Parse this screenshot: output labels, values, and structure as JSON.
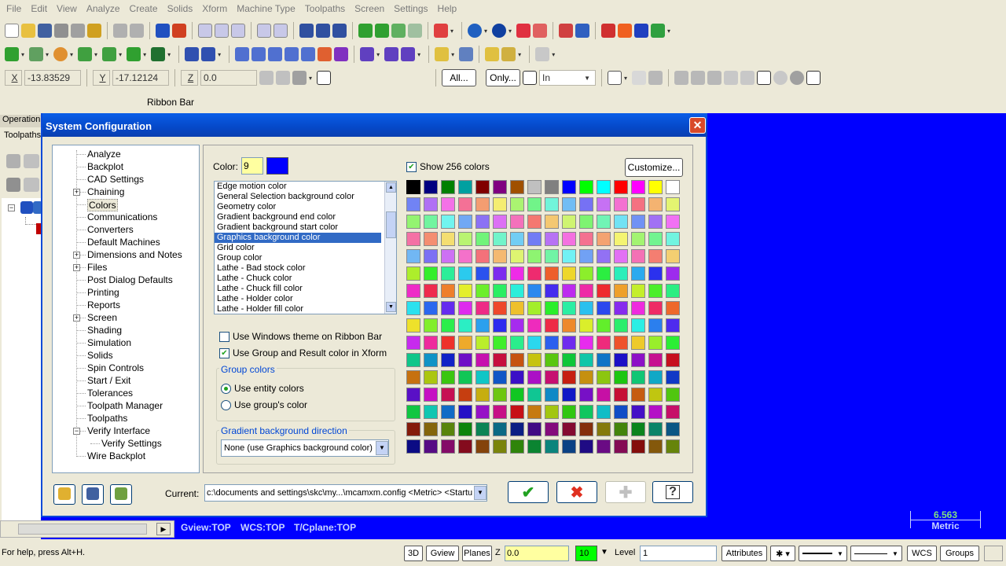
{
  "menu": [
    "File",
    "Edit",
    "View",
    "Analyze",
    "Create",
    "Solids",
    "Xform",
    "Machine Type",
    "Toolpaths",
    "Screen",
    "Settings",
    "Help"
  ],
  "coords": {
    "x_label": "X",
    "x_value": "-13.83529",
    "y_label": "Y",
    "y_value": "-17.12124",
    "z_label": "Z",
    "z_value": "0.0"
  },
  "ribbon": {
    "all_label": "All...",
    "only_label": "Only...",
    "units_value": "In",
    "ribbon_bar_label": "Ribbon Bar"
  },
  "left_panel": {
    "tab_label": "Operation",
    "tab_sub": "Toolpaths"
  },
  "dialog": {
    "title": "System Configuration",
    "tree_items": [
      "Analyze",
      "Backplot",
      "CAD Settings",
      "Chaining",
      "Colors",
      "Communications",
      "Converters",
      "Default Machines",
      "Dimensions and Notes",
      "Files",
      "Post Dialog Defaults",
      "Printing",
      "Reports",
      "Screen",
      "Shading",
      "Simulation",
      "Solids",
      "Spin Controls",
      "Start / Exit",
      "Tolerances",
      "Toolpath Manager",
      "Toolpaths",
      "Verify Interface",
      "Verify Settings",
      "Wire Backplot"
    ],
    "color_label": "Color:",
    "color_value": "9",
    "color_list": [
      "Edge motion color",
      "General Selection background color",
      "Geometry color",
      "Gradient background end color",
      "Gradient background start color",
      "Graphics background color",
      "Grid color",
      "Group color",
      "Lathe - Bad stock color",
      "Lathe - Chuck color",
      "Lathe - Chuck fill color",
      "Lathe - Holder color",
      "Lathe - Holder fill color"
    ],
    "selected_color_item": "Graphics background color",
    "use_windows_theme": "Use Windows theme on Ribbon Bar",
    "use_group_result": "Use Group and Result color in Xform",
    "group_colors_label": "Group colors",
    "use_entity_colors": "Use entity colors",
    "use_group_color": "Use group's color",
    "gradient_label": "Gradient background direction",
    "gradient_value": "None (use Graphics background color)",
    "show_256": "Show 256 colors",
    "customize": "Customize...",
    "current_label": "Current:",
    "current_value": "c:\\documents and settings\\skc\\my...\\mcamxm.config <Metric> <Startu"
  },
  "status": {
    "help": "For help, press Alt+H.",
    "view_3d": "3D",
    "gview": "Gview",
    "planes": "Planes",
    "z_label": "Z",
    "z_value": "0.0",
    "color_num": "10",
    "level_label": "Level",
    "level_value": "1",
    "attributes": "Attributes",
    "wcs": "WCS",
    "groups": "Groups"
  },
  "graphics": {
    "gview": "Gview:TOP",
    "wcs": "WCS:TOP",
    "tcplane": "T/Cplane:TOP",
    "scale_value": "6.563",
    "scale_unit": "Metric"
  },
  "palette_base": [
    "#000000",
    "#000080",
    "#008000",
    "#00a0a0",
    "#800000",
    "#800080",
    "#a05000",
    "#c0c0c0",
    "#808080",
    "#0000ff",
    "#00ff00",
    "#00ffff",
    "#ff0000",
    "#ff00ff",
    "#ffff00",
    "#ffffff"
  ],
  "colors": {
    "accent": "#0000ff",
    "title_bar": "#0548c8",
    "selection": "#316ac5"
  }
}
